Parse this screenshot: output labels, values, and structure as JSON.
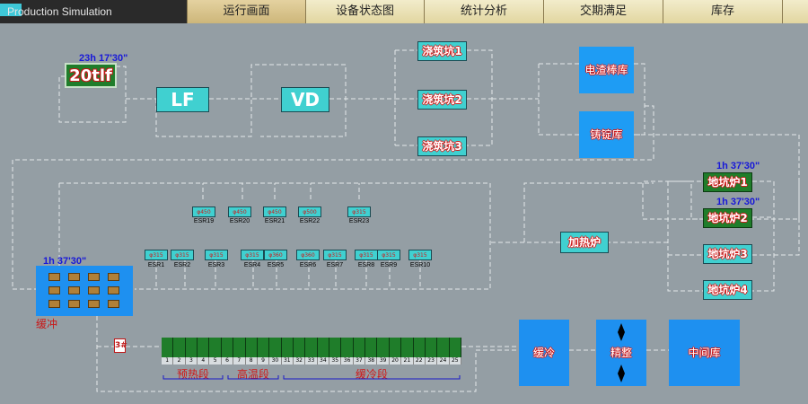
{
  "app": {
    "title": "Production Simulation"
  },
  "tabs": [
    {
      "label": "运行画面",
      "active": true
    },
    {
      "label": "设备状态图",
      "active": false
    },
    {
      "label": "统计分析",
      "active": false
    },
    {
      "label": "交期满足",
      "active": false
    },
    {
      "label": "库存",
      "active": false
    }
  ],
  "stations": {
    "converter": {
      "label": "20tlf",
      "timer": "23h 17'30\""
    },
    "lf": {
      "label": "LF"
    },
    "vd": {
      "label": "VD"
    },
    "pit1": {
      "label": "浇筑坑1"
    },
    "pit2": {
      "label": "浇筑坑2"
    },
    "pit3": {
      "label": "浇筑坑3"
    },
    "electroslag_store": {
      "label": "电渣棒库"
    },
    "ingot_store": {
      "label": "铸锭库"
    },
    "heating_furnace": {
      "label": "加热炉"
    },
    "pit_furnace1": {
      "label": "地坑炉1",
      "timer": "1h 37'30\""
    },
    "pit_furnace2": {
      "label": "地坑炉2",
      "timer": "1h 37'30\""
    },
    "pit_furnace3": {
      "label": "地坑炉3"
    },
    "pit_furnace4": {
      "label": "地坑炉4"
    }
  },
  "esr_top": [
    {
      "label": "ESR19",
      "spec": "φ450"
    },
    {
      "label": "ESR20",
      "spec": "φ450"
    },
    {
      "label": "ESR21",
      "spec": "φ450"
    },
    {
      "label": "ESR22",
      "spec": "φ500"
    },
    {
      "label": "ESR23",
      "spec": "φ315"
    }
  ],
  "esr_bottom": [
    {
      "label": "ESR1",
      "spec": "φ315"
    },
    {
      "label": "ESR2",
      "spec": "φ315"
    },
    {
      "label": "ESR3",
      "spec": "φ315"
    },
    {
      "label": "ESR4",
      "spec": "φ315"
    },
    {
      "label": "ESR5",
      "spec": "φ360"
    },
    {
      "label": "ESR6",
      "spec": "φ360"
    },
    {
      "label": "ESR7",
      "spec": "φ315"
    },
    {
      "label": "ESR8",
      "spec": "φ315"
    },
    {
      "label": "ESR9",
      "spec": "φ315"
    },
    {
      "label": "ESR10",
      "spec": "φ315"
    }
  ],
  "slow_cool_yard": {
    "label": "缓冲",
    "timer": "1h 37'30\""
  },
  "furnace_line": {
    "marker": "3#",
    "segments": [
      "1",
      "2",
      "3",
      "4",
      "5",
      "6",
      "7",
      "8",
      "9",
      "30",
      "31",
      "32",
      "33",
      "34",
      "35",
      "36",
      "37",
      "38",
      "39",
      "20",
      "21",
      "22",
      "23",
      "24",
      "25"
    ],
    "zones": [
      "预热段",
      "高温段",
      "缓冷段"
    ]
  },
  "downstream": {
    "slow_cool": {
      "label": "缓冷"
    },
    "finishing": {
      "label": "精整"
    },
    "intermediate": {
      "label": "中间库"
    }
  }
}
